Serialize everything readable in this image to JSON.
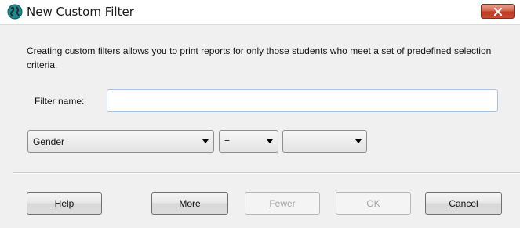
{
  "window": {
    "title": "New Custom Filter",
    "icon": "app-globe-icon",
    "close_icon": "close-icon"
  },
  "description": "Creating custom filters allows you to print reports for only those students who meet a set of predefined selection criteria.",
  "filter_name": {
    "label": "Filter name:",
    "value": "",
    "placeholder": ""
  },
  "criteria": {
    "field": "Gender",
    "operator": "=",
    "value": ""
  },
  "buttons": {
    "help": {
      "mnemonic": "H",
      "rest": "elp",
      "enabled": true
    },
    "more": {
      "mnemonic": "M",
      "rest": "ore",
      "enabled": true
    },
    "fewer": {
      "mnemonic": "F",
      "rest": "ewer",
      "enabled": false
    },
    "ok": {
      "mnemonic": "O",
      "rest": "K",
      "enabled": false
    },
    "cancel": {
      "mnemonic": "C",
      "rest": "ancel",
      "enabled": true
    }
  },
  "colors": {
    "close_button": "#c8432a",
    "dialog_background": "#f0f0f0"
  }
}
